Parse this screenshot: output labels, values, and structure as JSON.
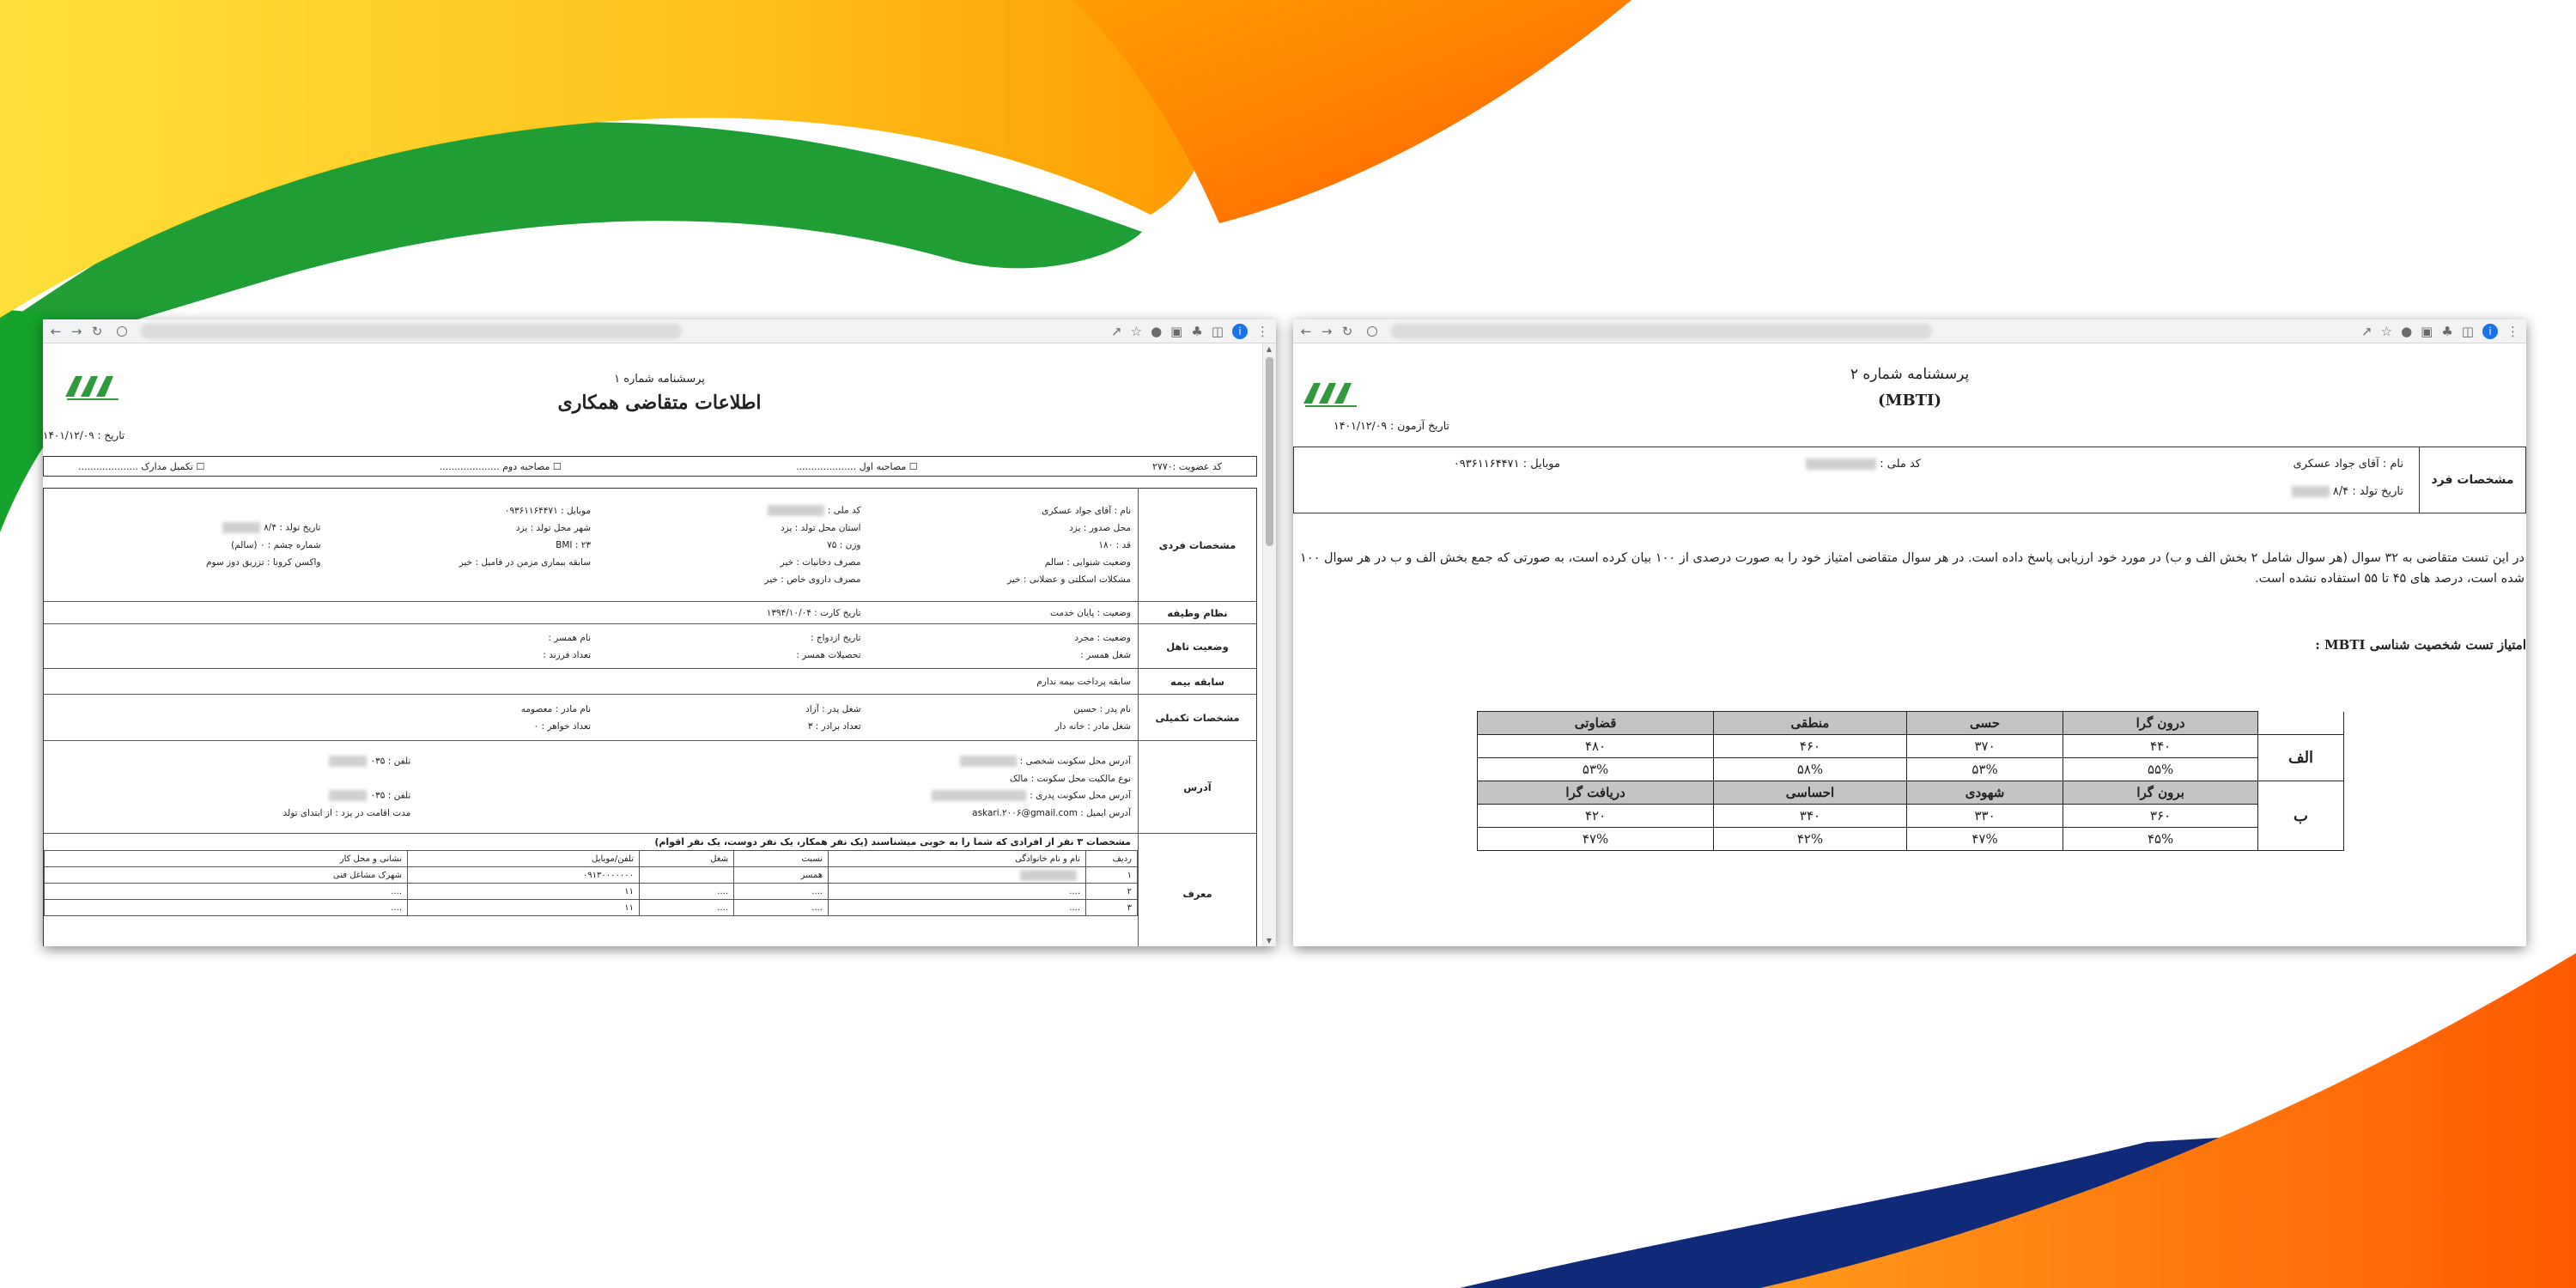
{
  "left_window": {
    "form_number": "پرسشنامه شماره ۱",
    "title": "اطلاعات متقاضی همکاری",
    "date": "تاریخ : ۱۴۰۱/۱۲/۰۹",
    "checks": {
      "membership": "کد عضویت :۲۷۷۰",
      "interview1": "☐ مصاحبه اول ....................",
      "interview2": "☐ مصاحبه دوم ....................",
      "complete_docs": "☐ تکمیل مدارک ...................."
    },
    "personal": {
      "label": "مشخصات فردی",
      "name": "نام : آقای جواد عسکری",
      "national_code": "کد ملی :",
      "mobile": "موبایل : ۰۹۳۶۱۱۶۴۴۷۱",
      "issue_place": "محل صدور : یزد",
      "birth_province": "استان محل تولد : یزد",
      "birth_city": "شهر محل تولد : یزد",
      "birth_date": "تاریخ تولد : ۸/۴",
      "height": "قد : ۱۸۰",
      "weight": "وزن : ۷۵",
      "bmi": "BMI : ۲۳",
      "eye": "شماره چشم : ۰ (سالم)",
      "hearing": "وضعیت شنوایی : سالم",
      "alcohol": "مصرف دخانیات : خیر",
      "family_illness": "سابقه بیماری مزمن در فامیل : خیر",
      "covid": "واکسن کرونا : تزریق دوز سوم",
      "bone": "مشکلات اسکلتی و عضلانی : خیر",
      "drugs": "مصرف داروی خاص : خیر"
    },
    "military": {
      "label": "نظام وظیفه",
      "status": "وضعیت : پایان خدمت",
      "card_date": "تاریخ کارت : ۱۳۹۴/۱۰/۰۴"
    },
    "marital": {
      "label": "وضعیت تاهل",
      "status": "وضعیت : مجرد",
      "marriage_date": "تاریخ ازدواج :",
      "spouse_name": "نام همسر :",
      "spouse_job": "شغل همسر :",
      "spouse_edu": "تحصیلات همسر :",
      "children": "تعداد فرزند :"
    },
    "insurance": {
      "label": "سابقه بیمه",
      "text": "سابقه پرداخت بیمه ندارم"
    },
    "extra": {
      "label": "مشخصات تکمیلی",
      "father_name": "نام پدر : حسین",
      "father_job": "شغل پدر : آزاد",
      "mother_name": "نام مادر : معصومه",
      "mother_job": "شغل مادر : خانه دار",
      "brothers": "تعداد برادر : ۳",
      "sisters": "تعداد خواهر : ۰"
    },
    "address": {
      "label": "آدرس",
      "personal": "آدرس محل سکونت شخصی :",
      "phone1": "تلفن : ۰۳۵",
      "ownership": "نوع مالکیت محل سکونت : مالک",
      "father_addr": "آدرس محل سکونت پدری :",
      "phone2": "تلفن : ۰۳۵",
      "email": "آدرس ایمیل : askari.۲۰۰۶@gmail.com",
      "residence": "مدت اقامت در یزد : از ابتدای تولد"
    },
    "referrer": {
      "label": "معرف",
      "title": "مشخصات ۳ نفر از افرادی که شما را به خوبی میشناسند (یک نفر همکار، یک نفر دوست، یک نفر اقوام)",
      "headers": [
        "ردیف",
        "نام و نام خانوادگی",
        "نسبت",
        "شغل",
        "تلفن/موبایل",
        "نشانی و محل کار"
      ],
      "rows": [
        [
          "۱",
          "",
          "همسر",
          "",
          "۰۹۱۳۰۰۰۰۰۰۰",
          "شهرک مشاغل فنی"
        ],
        [
          "۲",
          "....",
          "....",
          "....",
          "۱۱",
          "...."
        ],
        [
          "۳",
          "....",
          "....",
          "....",
          "۱۱",
          "...."
        ]
      ]
    }
  },
  "right_window": {
    "form_number": "پرسشنامه شماره ۲",
    "title": "(MBTI)",
    "date": "تاریخ آزمون : ۱۴۰۱/۱۲/۰۹",
    "person": {
      "label": "مشخصات فرد",
      "name": "نام : آقای جواد عسکری",
      "national_code": "کد ملی :",
      "mobile": "موبایل : ۰۹۳۶۱۱۶۴۴۷۱",
      "birth_date": "تاریخ تولد : ۸/۴"
    },
    "description": "در این تست متقاضی به ۳۲ سوال (هر سوال شامل ۲ بخش الف و ب) در مورد خود ارزیابی پاسخ داده است. در هر سوال متقاضی امتیاز خود را به صورت درصدی از ۱۰۰ بیان کرده است، به صورتی که جمع بخش الف و ب در هر سوال ۱۰۰ شده است، درصد های ۴۵ تا ۵۵ استفاده نشده است.",
    "score_title": "امتیاز تست شخصیت شناسی MBTI :",
    "mbti": {
      "group_a": "الف",
      "group_b": "ب",
      "a_headers": [
        "درون گرا",
        "حسی",
        "منطقی",
        "قضاوتی"
      ],
      "a_scores": [
        "۴۴۰",
        "۳۷۰",
        "۴۶۰",
        "۴۸۰"
      ],
      "a_percents": [
        "۵۵%",
        "۵۳%",
        "۵۸%",
        "۵۳%"
      ],
      "b_headers": [
        "برون گرا",
        "شهودی",
        "احساسی",
        "دریافت گرا"
      ],
      "b_scores": [
        "۳۶۰",
        "۳۳۰",
        "۳۴۰",
        "۴۲۰"
      ],
      "b_percents": [
        "۴۵%",
        "۴۷%",
        "۴۲%",
        "۴۷%"
      ]
    }
  },
  "colors": {
    "yellow": "#FFD21F",
    "orange": "#FF7A00",
    "green": "#17A52B",
    "navy": "#0E2A78",
    "logo_green": "#2E9A3C",
    "table_header": "#C4C4C4"
  }
}
